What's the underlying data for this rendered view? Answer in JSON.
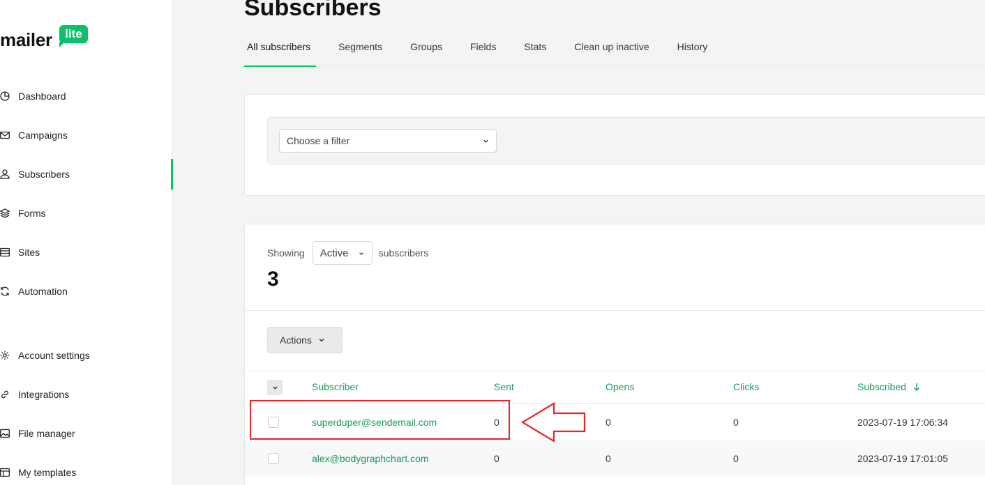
{
  "logo": {
    "text": "mailer",
    "badge": "lite"
  },
  "sidebar": {
    "items": [
      {
        "label": "Dashboard",
        "icon": "dashboard-icon"
      },
      {
        "label": "Campaigns",
        "icon": "mail-icon"
      },
      {
        "label": "Subscribers",
        "icon": "user-icon"
      },
      {
        "label": "Forms",
        "icon": "layers-icon"
      },
      {
        "label": "Sites",
        "icon": "browser-icon"
      },
      {
        "label": "Automation",
        "icon": "refresh-icon"
      },
      {
        "label": "Account settings",
        "icon": "gear-icon"
      },
      {
        "label": "Integrations",
        "icon": "link-icon"
      },
      {
        "label": "File manager",
        "icon": "image-icon"
      },
      {
        "label": "My templates",
        "icon": "template-icon"
      }
    ],
    "active": "Subscribers"
  },
  "page": {
    "title": "Subscribers"
  },
  "tabs": [
    "All subscribers",
    "Segments",
    "Groups",
    "Fields",
    "Stats",
    "Clean up inactive",
    "History"
  ],
  "filter": {
    "placeholder": "Choose a filter"
  },
  "list": {
    "showing_label": "Showing",
    "status_value": "Active",
    "subscribers_label": "subscribers",
    "count": "3",
    "actions_label": "Actions"
  },
  "table": {
    "headers": {
      "subscriber": "Subscriber",
      "sent": "Sent",
      "opens": "Opens",
      "clicks": "Clicks",
      "subscribed": "Subscribed"
    },
    "rows": [
      {
        "email": "superduper@sendemail.com",
        "sent": "0",
        "opens": "0",
        "clicks": "0",
        "subscribed": "2023-07-19 17:06:34"
      },
      {
        "email": "alex@bodygraphchart.com",
        "sent": "0",
        "opens": "0",
        "clicks": "0",
        "subscribed": "2023-07-19 17:01:05"
      }
    ]
  },
  "colors": {
    "accent": "#09c269",
    "link": "#1c9a59",
    "annotation": "#e5262b"
  }
}
